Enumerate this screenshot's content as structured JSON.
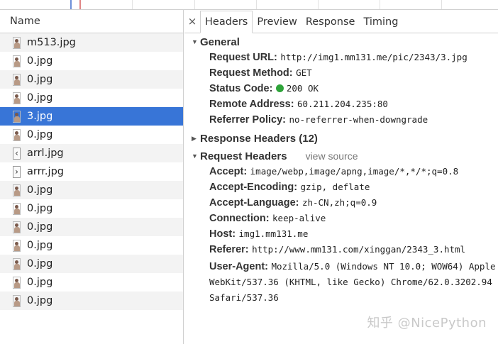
{
  "list": {
    "header": "Name",
    "rows": [
      {
        "name": "m513.jpg",
        "icon": "image-thumb-icon"
      },
      {
        "name": "0.jpg",
        "icon": "image-thumb-icon"
      },
      {
        "name": "0.jpg",
        "icon": "image-thumb-icon"
      },
      {
        "name": "0.jpg",
        "icon": "image-thumb-icon"
      },
      {
        "name": "3.jpg",
        "icon": "image-thumb-icon",
        "selected": true
      },
      {
        "name": "0.jpg",
        "icon": "image-thumb-icon"
      },
      {
        "name": "arrl.jpg",
        "icon": "arrow-left-icon"
      },
      {
        "name": "arrr.jpg",
        "icon": "arrow-right-icon"
      },
      {
        "name": "0.jpg",
        "icon": "image-thumb-icon"
      },
      {
        "name": "0.jpg",
        "icon": "image-thumb-icon"
      },
      {
        "name": "0.jpg",
        "icon": "image-thumb-icon"
      },
      {
        "name": "0.jpg",
        "icon": "image-thumb-icon"
      },
      {
        "name": "0.jpg",
        "icon": "image-thumb-icon"
      },
      {
        "name": "0.jpg",
        "icon": "image-thumb-icon"
      },
      {
        "name": "0.jpg",
        "icon": "image-thumb-icon"
      }
    ]
  },
  "tabs": {
    "close": "×",
    "items": [
      "Headers",
      "Preview",
      "Response",
      "Timing"
    ],
    "active": "Headers"
  },
  "general": {
    "title": "General",
    "request_url_key": "Request URL:",
    "request_url": "http://img1.mm131.me/pic/2343/3.jpg",
    "method_key": "Request Method:",
    "method": "GET",
    "status_key": "Status Code:",
    "status": "200 OK",
    "status_color": "#2fa43a",
    "remote_key": "Remote Address:",
    "remote": "60.211.204.235:80",
    "referrer_key": "Referrer Policy:",
    "referrer": "no-referrer-when-downgrade"
  },
  "response_headers": {
    "title": "Response Headers (12)"
  },
  "request_headers": {
    "title": "Request Headers",
    "view_source": "view source",
    "accept_key": "Accept:",
    "accept": "image/webp,image/apng,image/*,*/*;q=0.8",
    "encoding_key": "Accept-Encoding:",
    "encoding": "gzip, deflate",
    "language_key": "Accept-Language:",
    "language": "zh-CN,zh;q=0.9",
    "connection_key": "Connection:",
    "connection": "keep-alive",
    "host_key": "Host:",
    "host": "img1.mm131.me",
    "referer_key": "Referer:",
    "referer": "http://www.mm131.com/xinggan/2343_3.html",
    "ua_key": "User-Agent:",
    "ua": "Mozilla/5.0 (Windows NT 10.0; WOW64) AppleWebKit/537.36 (KHTML, like Gecko) Chrome/62.0.3202.94 Safari/537.36"
  },
  "watermark": "知乎 @NicePython",
  "colors": {
    "selected_row": "#3875d7",
    "alt_row": "#f3f3f3"
  }
}
